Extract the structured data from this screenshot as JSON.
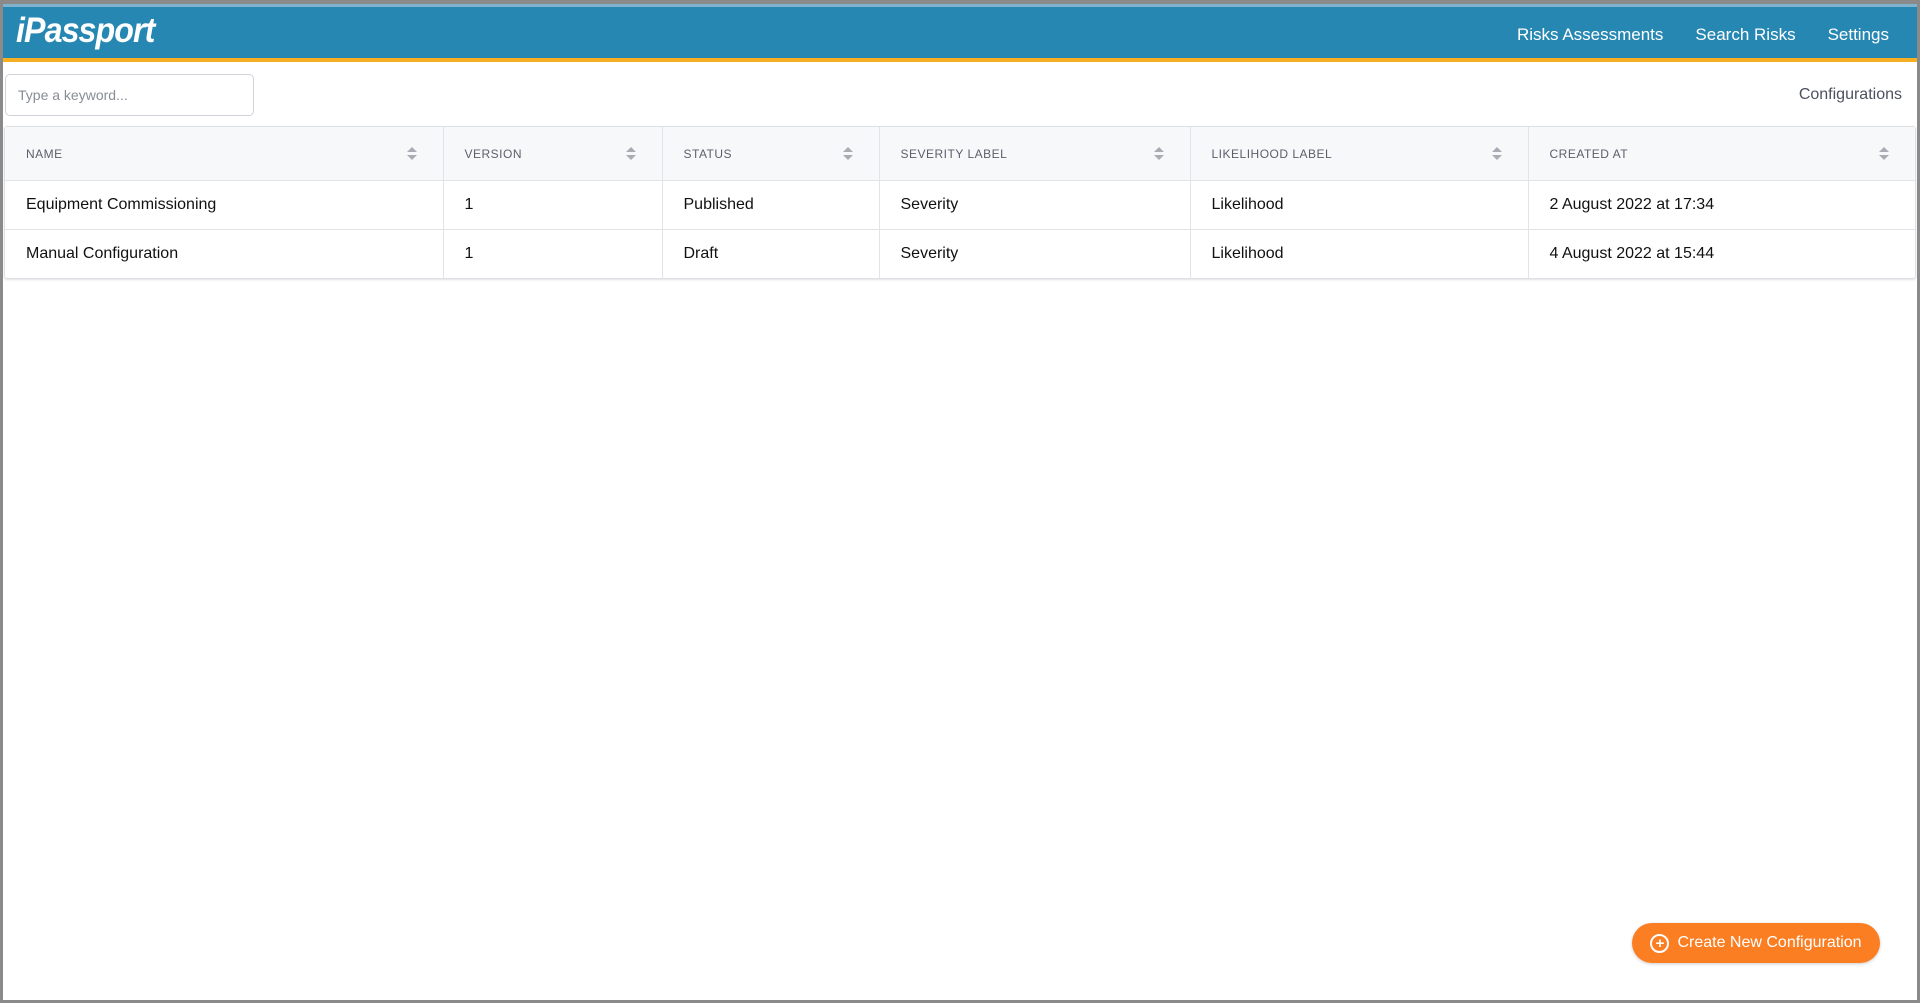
{
  "header": {
    "logo": "iPassport",
    "nav": [
      "Risks Assessments",
      "Search Risks",
      "Settings"
    ]
  },
  "search": {
    "placeholder": "Type a keyword...",
    "value": ""
  },
  "breadcrumb": "Configurations",
  "table": {
    "columns": [
      "NAME",
      "VERSION",
      "STATUS",
      "SEVERITY LABEL",
      "LIKELIHOOD LABEL",
      "CREATED AT"
    ],
    "rows": [
      [
        "Equipment Commissioning",
        "1",
        "Published",
        "Severity",
        "Likelihood",
        "2 August 2022 at 17:34"
      ],
      [
        "Manual Configuration",
        "1",
        "Draft",
        "Severity",
        "Likelihood",
        "4 August 2022 at 15:44"
      ]
    ]
  },
  "create_button": {
    "label": "Create New Configuration",
    "icon": "plus-circle-icon"
  },
  "colors": {
    "brand": "#2787b3",
    "accent": "#f6ae22",
    "button": "#fb7e22"
  }
}
